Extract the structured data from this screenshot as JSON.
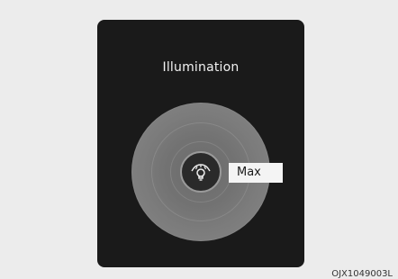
{
  "screen": {
    "title": "Illumination",
    "dial": {
      "value_label": "Max",
      "icon": "instrument-illumination-icon"
    }
  },
  "caption": "OJX1049003L",
  "colors": {
    "screen_bg": "#1a1a1a",
    "page_bg": "#ececec",
    "label_bg": "#f4f4f4",
    "dial": "#7a7a7a"
  }
}
